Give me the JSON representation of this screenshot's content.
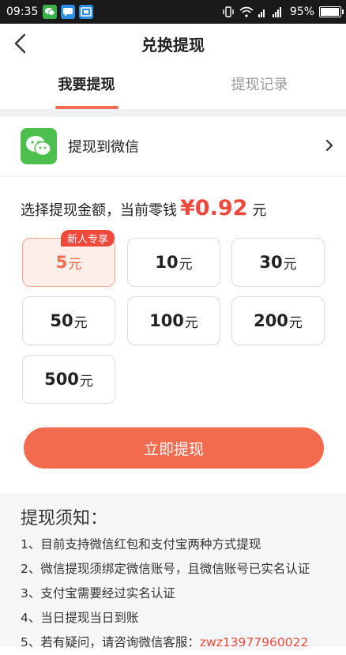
{
  "status_bar": {
    "time": "09:35",
    "battery": "95%",
    "battery_level": 0.95
  },
  "nav": {
    "title": "兑换提现"
  },
  "tabs": [
    {
      "label": "我要提现",
      "active": true
    },
    {
      "label": "提现记录",
      "active": false
    }
  ],
  "wechat": {
    "label": "提现到微信",
    "icon": "wechat-icon"
  },
  "balance": {
    "prefix": "选择提现金额，当前零钱",
    "symbol": "¥",
    "amount": "0.92",
    "unit": "元"
  },
  "options": [
    {
      "value": "5",
      "unit": "元",
      "selected": true,
      "badge": "新人专享"
    },
    {
      "value": "10",
      "unit": "元",
      "selected": false
    },
    {
      "value": "30",
      "unit": "元",
      "selected": false
    },
    {
      "value": "50",
      "unit": "元",
      "selected": false
    },
    {
      "value": "100",
      "unit": "元",
      "selected": false
    },
    {
      "value": "200",
      "unit": "元",
      "selected": false
    },
    {
      "value": "500",
      "unit": "元",
      "selected": false
    }
  ],
  "submit": {
    "label": "立即提现"
  },
  "notes": {
    "title": "提现须知：",
    "items": [
      "1、目前支持微信红包和支付宝两种方式提现",
      "2、微信提现须绑定微信账号，且微信账号已实名认证",
      "3、支付宝需要经过实名认证",
      "4、当日提现当日到账"
    ],
    "contact_prefix": "5、若有疑问，请咨询微信客服：",
    "contact": "zwz13977960022"
  },
  "colors": {
    "accent": "#f26b4f",
    "price": "#f0483a",
    "wechat": "#4cbf4f"
  }
}
